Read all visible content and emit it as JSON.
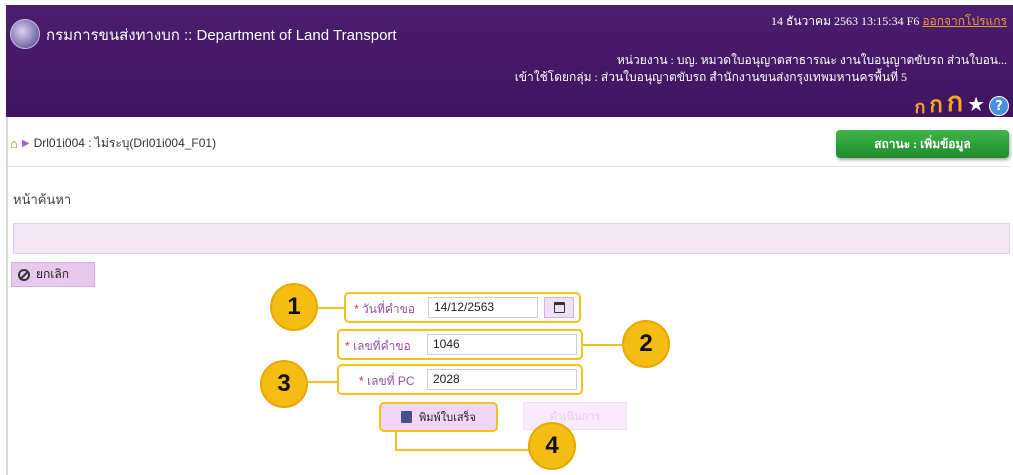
{
  "header": {
    "app_title": "กรมการขนส่งทางบก :: Department of Land Transport",
    "datetime": "14 ธันวาคม 2563 13:15:34 F6",
    "logout": "ออกจากโปรแกร",
    "unit": "หน่วยงาน : บญ. หมวดใบอนุญาตสาธารณะ งานใบอนุญาตขับรถ ส่วนใบอน...",
    "group": "เข้าใช้โดยกลุ่ม : ส่วนใบอนุญาตขับรถ สำนักงานขนส่งกรุงเทพมหานครพื้นที่ 5",
    "font_small": "ก",
    "font_medium": "ก",
    "font_large": "ก",
    "help": "?"
  },
  "breadcrumb": {
    "text": "Drl01i004 : ไม่ระบุ(Drl01i004_F01)"
  },
  "status_button": "สถานะ : เพิ่มข้อมูล",
  "section_title": "หน้าค้นหา",
  "cancel_button": "ยกเลิก",
  "form": {
    "request_date": {
      "label": "วันที่คำขอ",
      "value": "14/12/2563"
    },
    "request_no": {
      "label": "เลขที่คำขอ",
      "value": "1046"
    },
    "pc_no": {
      "label": "เลขที่ PC",
      "value": "2028"
    }
  },
  "print_button": "พิมพ์ใบเสร็จ",
  "process_button": "ดำเนินการ",
  "callouts": [
    "1",
    "2",
    "3",
    "4"
  ],
  "colors": {
    "header_bg": "#4b1e6e",
    "accent_yellow": "#f5bd13",
    "status_green": "#2aa034",
    "label_purple": "#9b4fb0"
  }
}
